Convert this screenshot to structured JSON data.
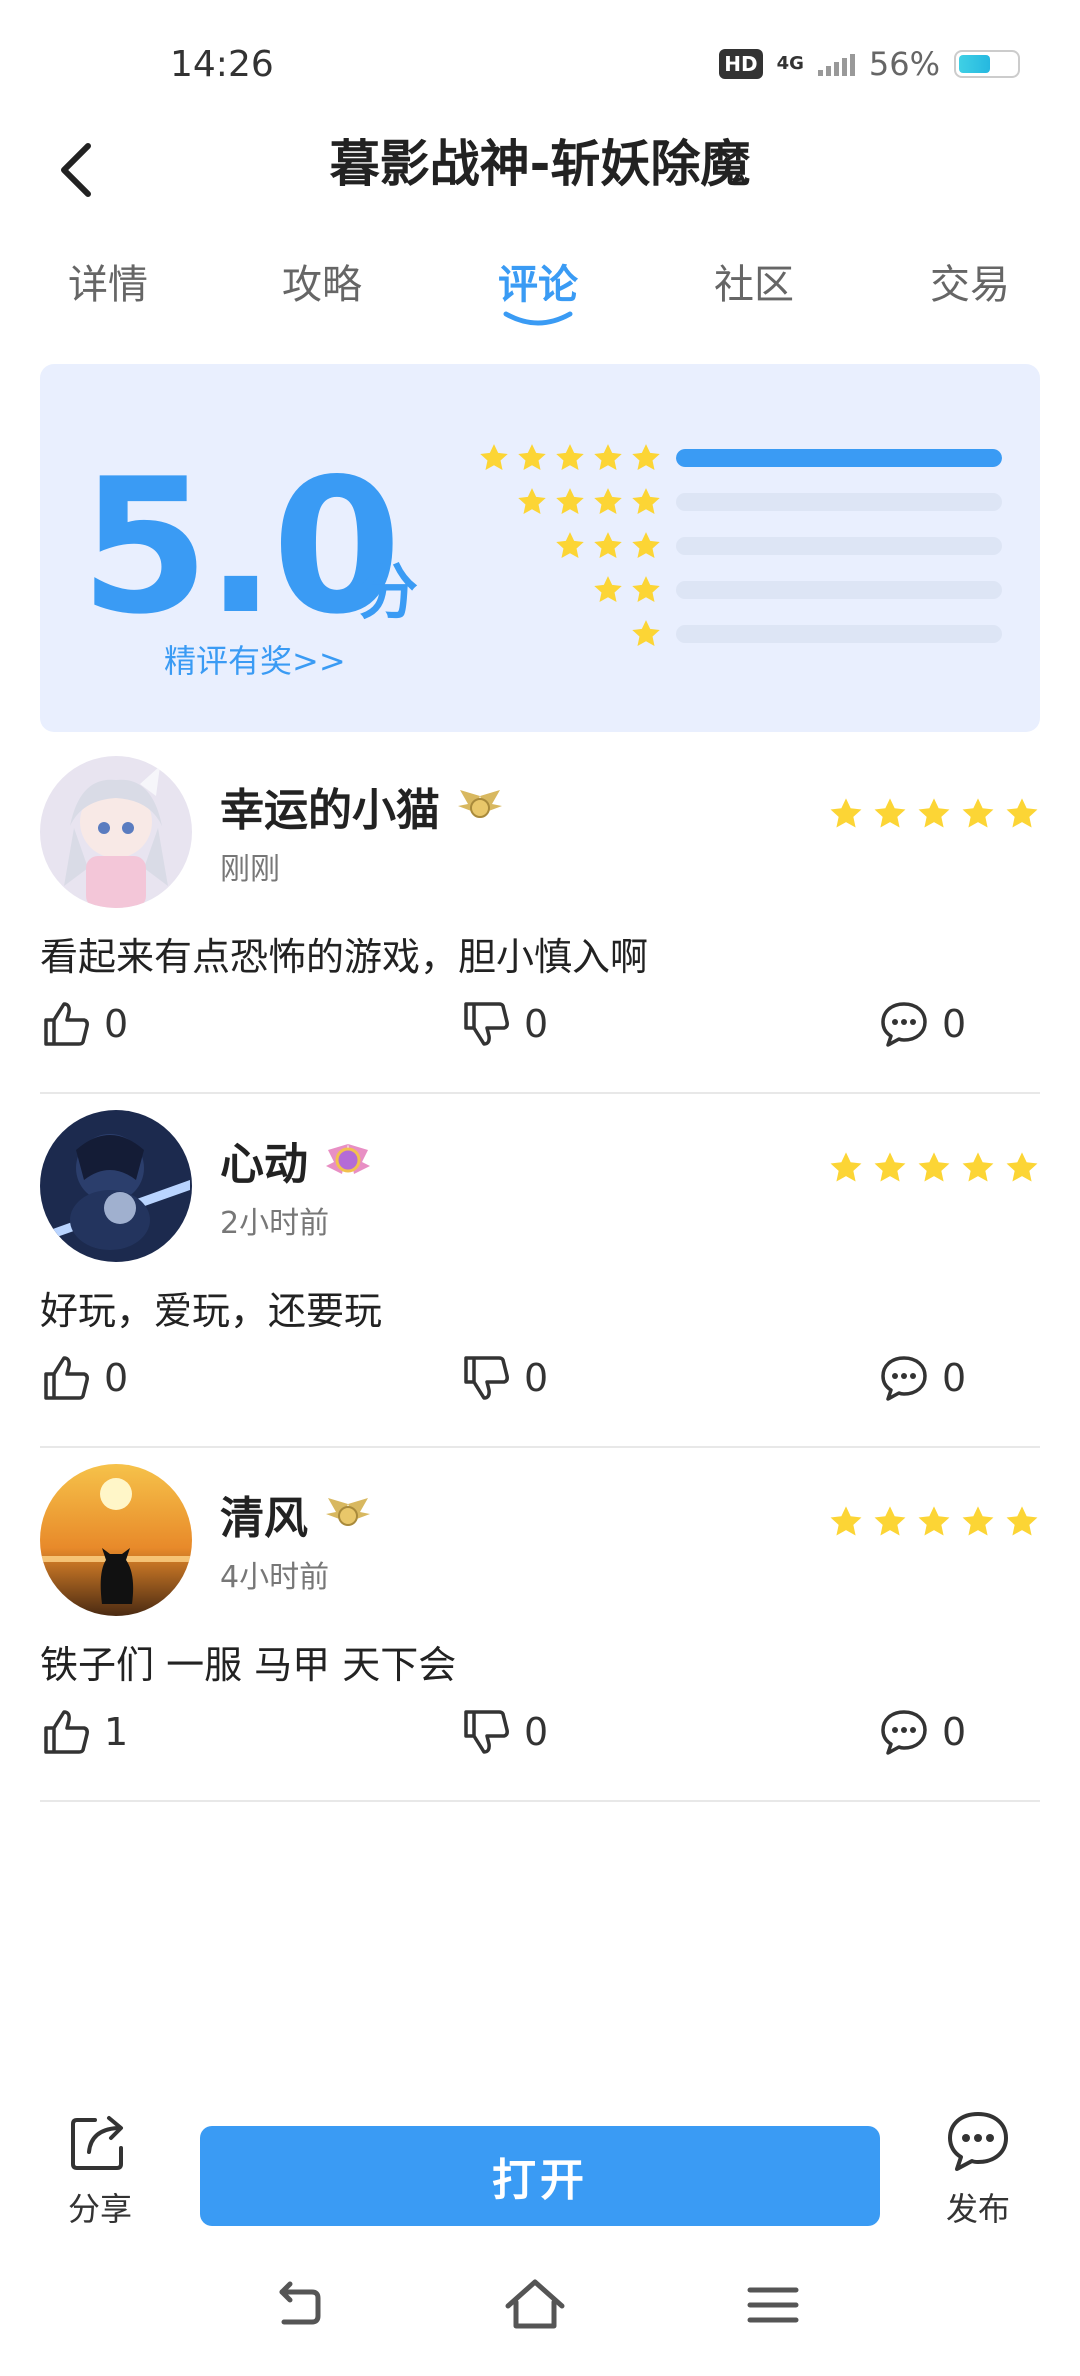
{
  "status_bar": {
    "time": "14:26",
    "hd": "HD",
    "network": "4G",
    "battery_text": "56%",
    "battery_level": 0.56
  },
  "header": {
    "title": "暮影战神-斩妖除魔"
  },
  "tabs": [
    {
      "label": "详情",
      "active": false
    },
    {
      "label": "攻略",
      "active": false
    },
    {
      "label": "评论",
      "active": true
    },
    {
      "label": "社区",
      "active": false
    },
    {
      "label": "交易",
      "active": false
    }
  ],
  "rating": {
    "score": "5.0",
    "unit": "分",
    "reward_link": "精评有奖>>",
    "distribution": [
      {
        "stars": 5,
        "fraction": 1.0
      },
      {
        "stars": 4,
        "fraction": 0.0
      },
      {
        "stars": 3,
        "fraction": 0.0
      },
      {
        "stars": 2,
        "fraction": 0.0
      },
      {
        "stars": 1,
        "fraction": 0.0
      }
    ]
  },
  "reviews": [
    {
      "username": "幸运的小猫",
      "time": "刚刚",
      "stars": 5,
      "text": "看起来有点恐怖的游戏，胆小慎入啊",
      "likes": "0",
      "dislikes": "0",
      "comments": "0",
      "badge_icon": "gold-wings-badge-icon",
      "avatar": "anime-girl-avatar"
    },
    {
      "username": "心动",
      "time": "2小时前",
      "stars": 5,
      "text": "好玩，爱玩，还要玩",
      "likes": "0",
      "dislikes": "0",
      "comments": "0",
      "badge_icon": "purple-crest-badge-icon",
      "avatar": "anime-swordsman-avatar"
    },
    {
      "username": "清风",
      "time": "4小时前",
      "stars": 5,
      "text": "铁子们 一服 马甲 天下会",
      "likes": "1",
      "dislikes": "0",
      "comments": "0",
      "badge_icon": "gold-wings-badge-icon",
      "avatar": "cat-sunset-avatar"
    }
  ],
  "bottom_bar": {
    "share_label": "分享",
    "open_label": "打开",
    "publish_label": "发布"
  },
  "colors": {
    "accent": "#3a9bf4",
    "star": "#fcd535",
    "card_bg": "#e9effe"
  }
}
